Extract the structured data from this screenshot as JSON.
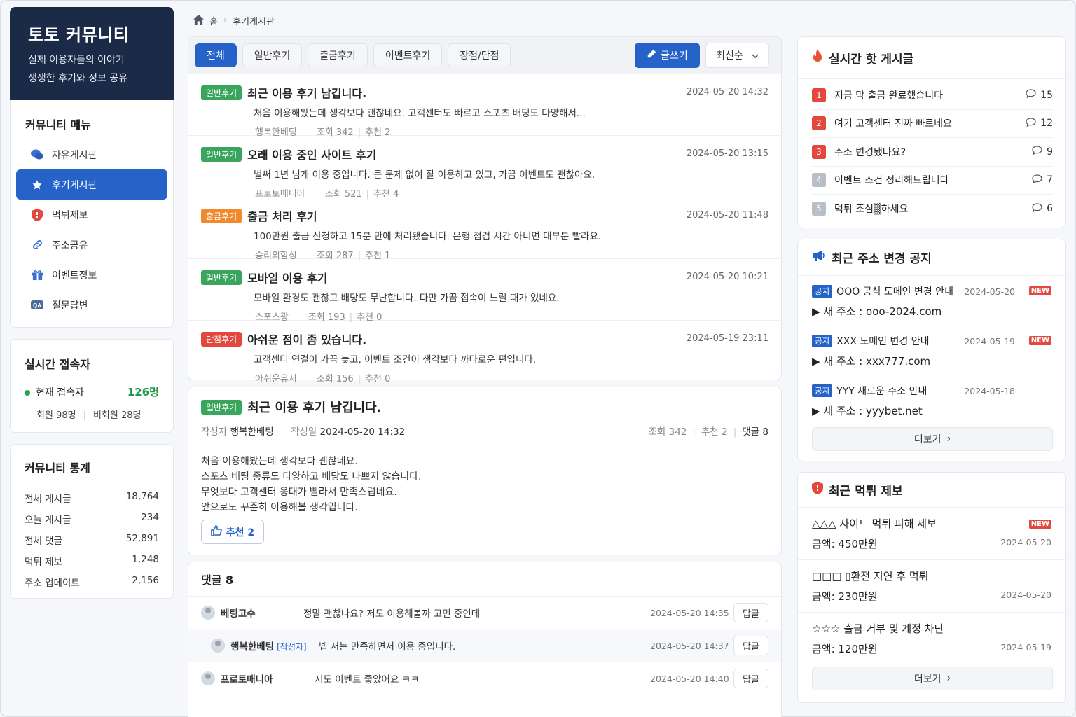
{
  "brand": {
    "title": "토토 커뮤니티",
    "line1": "실제 이용자들의 이야기",
    "line2": "생생한 후기와 정보 공유"
  },
  "menu": {
    "title": "커뮤니티 메뉴",
    "items": [
      {
        "label": "자유게시판",
        "icon": "chat-bubbles-icon"
      },
      {
        "label": "후기게시판",
        "icon": "star-icon"
      },
      {
        "label": "먹튀제보",
        "icon": "shield-icon"
      },
      {
        "label": "주소공유",
        "icon": "link-icon"
      },
      {
        "label": "이벤트정보",
        "icon": "gift-icon"
      },
      {
        "label": "질문답변",
        "icon": "qa-icon"
      }
    ]
  },
  "online": {
    "title": "실시간 접속자",
    "label": "현재 접속자",
    "count": "126명",
    "members": "회원 98명",
    "guests": "비회원 28명"
  },
  "stats": {
    "title": "커뮤니티 통계",
    "rows": [
      {
        "label": "전체 게시글",
        "value": "18,764"
      },
      {
        "label": "오늘 게시글",
        "value": "234"
      },
      {
        "label": "전체 댓글",
        "value": "52,891"
      },
      {
        "label": "먹튀 제보",
        "value": "1,248"
      },
      {
        "label": "주소 업데이트",
        "value": "2,156"
      }
    ]
  },
  "breadcrumb": {
    "home": "홈",
    "current": "후기게시판"
  },
  "tabs": [
    "전체",
    "일반후기",
    "출금후기",
    "이벤트후기",
    "장점/단점"
  ],
  "toolbar": {
    "write": "글쓰기",
    "sort": "최신순"
  },
  "posts": [
    {
      "badge": "일반후기",
      "title": "최근 이용 후기 남깁니다.",
      "date": "2024-05-20 14:32",
      "body": "처음 이용해봤는데 생각보다 괜찮네요. 고객센터도 빠르고 스포츠 배팅도 다양해서...",
      "author": "행복한베팅",
      "views": "조회 342",
      "rec": "추천 2"
    },
    {
      "badge": "일반후기",
      "title": "오래 이용 중인 사이트 후기",
      "date": "2024-05-20 13:15",
      "body": "벌써 1년 넘게 이용 중입니다. 큰 문제 없이 잘 이용하고 있고, 가끔 이벤트도 괜찮아요.",
      "author": "프로토매니아",
      "views": "조회 521",
      "rec": "추천 4"
    },
    {
      "badge": "출금후기",
      "title": "출금 처리 후기",
      "date": "2024-05-20 11:48",
      "body": "100만원 출금 신청하고 15분 만에 처리됐습니다. 은행 점검 시간 아니면 대부분 빨라요.",
      "author": "승리의함성",
      "views": "조회 287",
      "rec": "추천 1"
    },
    {
      "badge": "일반후기",
      "title": "모바일 이용 후기",
      "date": "2024-05-20 10:21",
      "body": "모바일 환경도 괜찮고 배당도 무난합니다. 다만 가끔 접속이 느릴 때가 있네요.",
      "author": "스포츠광",
      "views": "조회 193",
      "rec": "추천 0"
    },
    {
      "badge": "단점후기",
      "title": "아쉬운 점이 좀 있습니다.",
      "date": "2024-05-19 23:11",
      "body": "고객센터 연결이 가끔 늦고, 이벤트 조건이 생각보다 까다로운 편입니다.",
      "author": "아쉬운유저",
      "views": "조회 156",
      "rec": "추천 0"
    }
  ],
  "detail": {
    "badge": "일반후기",
    "title": "최근 이용 후기 남깁니다.",
    "author_label": "작성자",
    "author": "행복한베팅",
    "date_label": "작성일",
    "date": "2024-05-20 14:32",
    "views": "조회 342",
    "rec": "추천 2",
    "cmts": "댓글 8",
    "lines": [
      "처음 이용해봤는데 생각보다 괜찮네요.",
      "스포츠 배팅 종류도 다양하고 배당도 나쁘지 않습니다.",
      "무엇보다 고객센터 응대가 빨라서 만족스럽네요.",
      "앞으로도 꾸준히 이용해볼 생각입니다."
    ],
    "rec_button": "추천 2"
  },
  "comments": {
    "title": "댓글 8",
    "reply_label": "답글",
    "items": [
      {
        "user": "베팅고수",
        "text": "정말 괜찮나요? 저도 이용해볼까 고민 중인데",
        "time": "2024-05-20 14:35"
      },
      {
        "user": "행복한베팅",
        "tag": "[작성자]",
        "text": "넵 저는 만족하면서 이용 중입니다.",
        "time": "2024-05-20 14:37"
      },
      {
        "user": "프로토매니아",
        "text": "저도 이벤트 좋았어요 ㅋㅋ",
        "time": "2024-05-20 14:40"
      }
    ]
  },
  "hot": {
    "title": "실시간 핫 게시글",
    "items": [
      {
        "rank": "1",
        "title": "지금 막 출금 완료했습니다",
        "count": "15"
      },
      {
        "rank": "2",
        "title": "여기 고객센터 진짜 빠르네요",
        "count": "12"
      },
      {
        "rank": "3",
        "title": "주소 변경됐나요?",
        "count": "9"
      },
      {
        "rank": "4",
        "title": "이벤트 조건 정리해드립니다",
        "count": "7"
      },
      {
        "rank": "5",
        "title": "먹튀 조심▒하세요",
        "count": "6"
      }
    ]
  },
  "notice": {
    "title": "최근 주소 변경 공지",
    "tag": "공지",
    "new": "NEW",
    "items": [
      {
        "title": "OOO 공식 도메인 변경 안내",
        "date": "2024-05-20",
        "addr": "▶ 새 주소 : ooo-2024.com",
        "is_new": true
      },
      {
        "title": "XXX 도메인 변경 안내",
        "date": "2024-05-19",
        "addr": "▶ 새 주소 : xxx777.com",
        "is_new": true
      },
      {
        "title": "YYY 새로운 주소 안내",
        "date": "2024-05-18",
        "addr": "▶ 새 주소 : yyybet.net",
        "is_new": false
      }
    ],
    "more": "더보기"
  },
  "scam": {
    "title": "최근 먹튀 제보",
    "new": "NEW",
    "items": [
      {
        "title": "△△△ 사이트 먹튀 피해 제보",
        "amount": "금액: 450만원",
        "date": "2024-05-20"
      },
      {
        "title": "□□□ ▯환전 지연 후 먹튀",
        "amount": "금액: 230만원",
        "date": "2024-05-20"
      },
      {
        "title": "☆☆☆ 출금 거부 및 계정 차단",
        "amount": "금액: 120만원",
        "date": "2024-05-19"
      }
    ],
    "more": "더보기"
  },
  "colors": {
    "primary": "#2563c9",
    "brand": "#1b2a47",
    "green": "#3aa55c",
    "orange": "#ef8a2e",
    "red": "#e2483d"
  }
}
